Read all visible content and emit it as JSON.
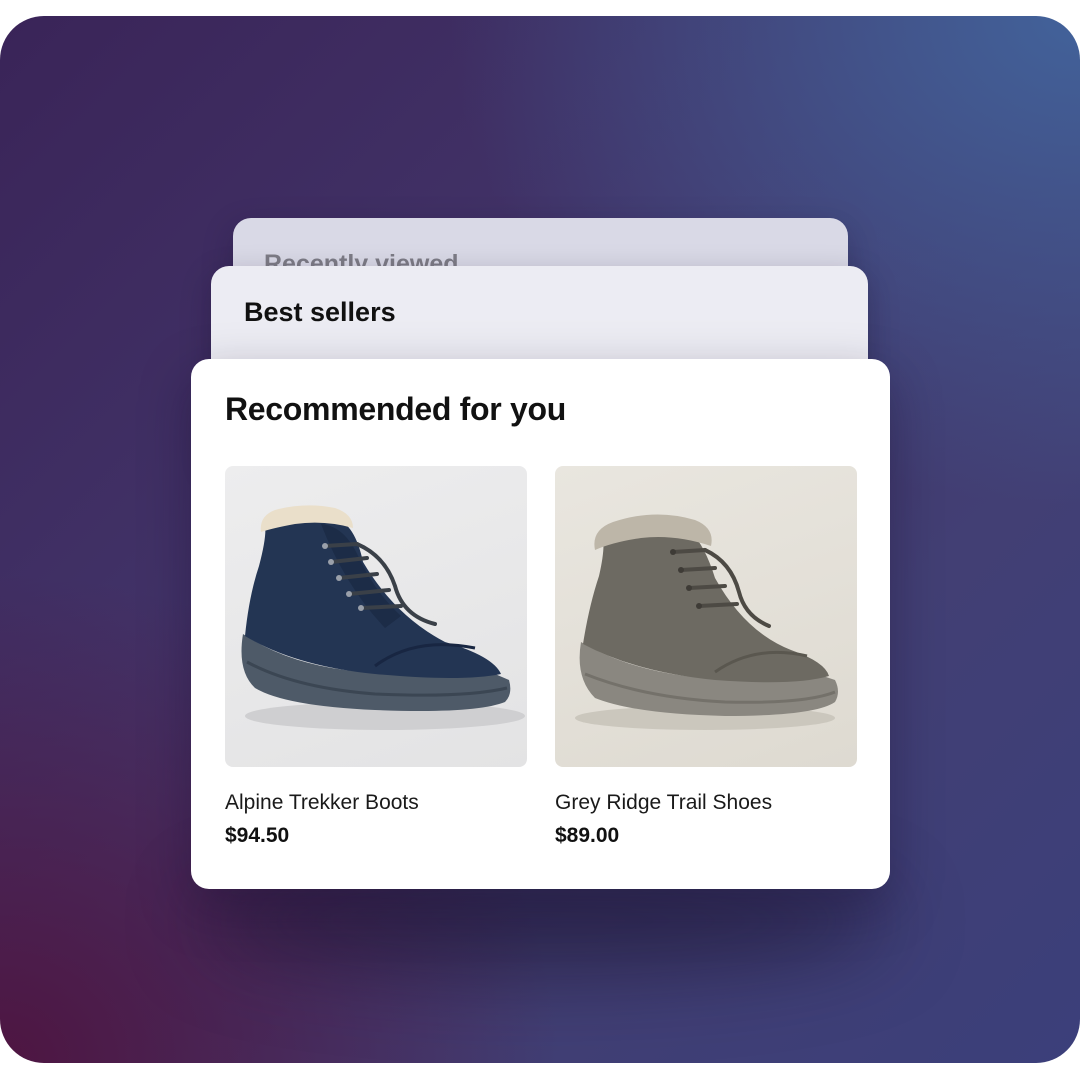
{
  "stack": {
    "back_card_title": "Recently viewed",
    "middle_card_title": "Best sellers",
    "front_card_title": "Recommended for you"
  },
  "products": [
    {
      "name": "Alpine Trekker Boots",
      "price": "$94.50",
      "image_icon": "navy-boot-image",
      "color": "#1f2f4c"
    },
    {
      "name": "Grey Ridge Trail Shoes",
      "price": "$89.00",
      "image_icon": "grey-boot-image",
      "color": "#6f6c64"
    }
  ],
  "colors": {
    "background_top_right": "#42629a",
    "background_bottom_left": "#4e1541"
  }
}
